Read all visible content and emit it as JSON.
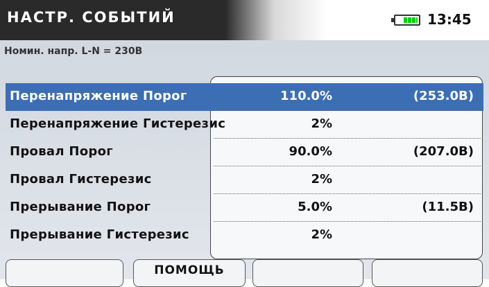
{
  "header": {
    "title": "НАСТР. СОБЫТИЙ",
    "time": "13:45",
    "battery_icon": "battery-icon"
  },
  "nominal_voltage": "Номин. напр. L-N = 230В",
  "rows": [
    {
      "label": "Перенапряжение Порог",
      "value": "110.0%",
      "voltage": "(253.0В)",
      "selected": true
    },
    {
      "label": "Перенапряжение Гистерезис",
      "value": "2%",
      "voltage": "",
      "selected": false
    },
    {
      "label": "Провал Порог",
      "value": "90.0%",
      "voltage": "(207.0В)",
      "selected": false
    },
    {
      "label": "Провал Гистерезис",
      "value": "2%",
      "voltage": "",
      "selected": false
    },
    {
      "label": "Прерывание Порог",
      "value": "5.0%",
      "voltage": "(11.5В)",
      "selected": false
    },
    {
      "label": "Прерывание Гистерезис",
      "value": "2%",
      "voltage": "",
      "selected": false
    }
  ],
  "function_keys": [
    "",
    "ПОМОЩЬ",
    "",
    ""
  ],
  "colors": {
    "selection": "#3c6eb4",
    "title_bar": "#2a2a2a",
    "battery": "#00d000"
  }
}
